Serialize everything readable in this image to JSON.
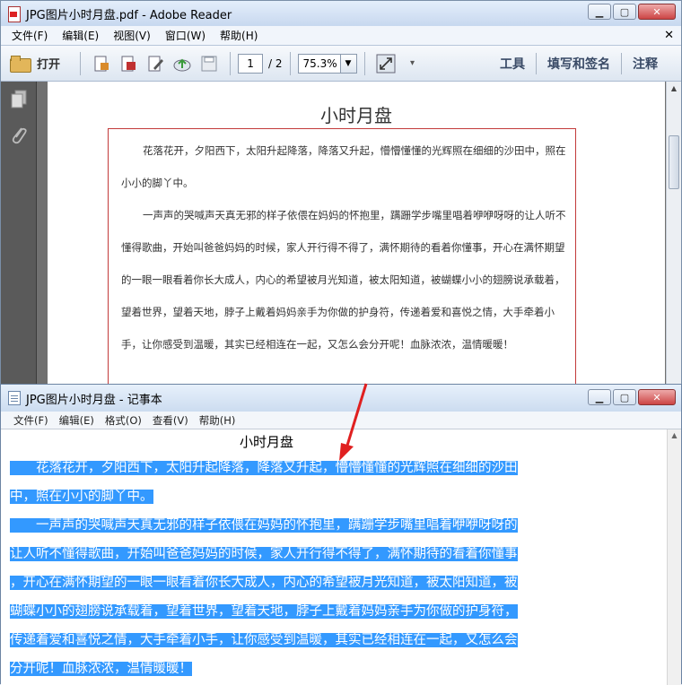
{
  "reader": {
    "title": "JPG图片小时月盘.pdf - Adobe Reader",
    "menu": [
      "文件(F)",
      "编辑(E)",
      "视图(V)",
      "窗口(W)",
      "帮助(H)"
    ],
    "toolbar": {
      "open_label": "打开",
      "page_current": "1",
      "page_total": "/ 2",
      "zoom": "75.3%",
      "right_buttons": [
        "工具",
        "填写和签名",
        "注释"
      ]
    },
    "document": {
      "title": "小时月盘",
      "paragraphs": [
        "花落花开，夕阳西下，太阳升起降落，降落又升起，懵懵懂懂的光辉照在细细的沙田中，照在小小的脚丫中。",
        "一声声的哭喊声天真无邪的样子依偎在妈妈的怀抱里，蹒跚学步嘴里唱着咿咿呀呀的让人听不懂得歌曲，开始叫爸爸妈妈的时候，家人开行得不得了，满怀期待的看着你懂事，开心在满怀期望的一眼一眼看着你长大成人，内心的希望被月光知道，被太阳知道，被蝴蝶小小的翅膀说承载着，望着世界，望着天地，脖子上戴着妈妈亲手为你做的护身符，传递着爱和喜悦之情，大手牵着小手，让你感受到温暖，其实已经相连在一起，又怎么会分开呢！血脉浓浓，温情暖暖！"
      ]
    }
  },
  "notepad": {
    "title": "JPG图片小时月盘 - 记事本",
    "menu": [
      "文件(F)",
      "编辑(E)",
      "格式(O)",
      "查看(V)",
      "帮助(H)"
    ],
    "heading": "小时月盘",
    "lines": [
      "　　花落花开，夕阳西下，太阳升起降落，降落又升起，懵懵懂懂的光辉照在细细的沙田",
      "中，照在小小的脚丫中。",
      "　　一声声的哭喊声天真无邪的样子依偎在妈妈的怀抱里，蹒跚学步嘴里唱着咿咿呀呀的",
      "让人听不懂得歌曲，开始叫爸爸妈妈的时候，家人开行得不得了，满怀期待的看着你懂事",
      "，开心在满怀期望的一眼一眼看着你长大成人，内心的希望被月光知道，被太阳知道，被",
      "蝴蝶小小的翅膀说承载着，望着世界，望着天地，脖子上戴着妈妈亲手为你做的护身符，",
      "传递着爱和喜悦之情，大手牵着小手，让你感受到温暖，其实已经相连在一起，又怎么会",
      "分开呢！血脉浓浓，温情暖暖！"
    ]
  },
  "colors": {
    "selection": "#3399ff",
    "annotation_red": "#e02020",
    "pdf_border": "#c23a3a"
  }
}
